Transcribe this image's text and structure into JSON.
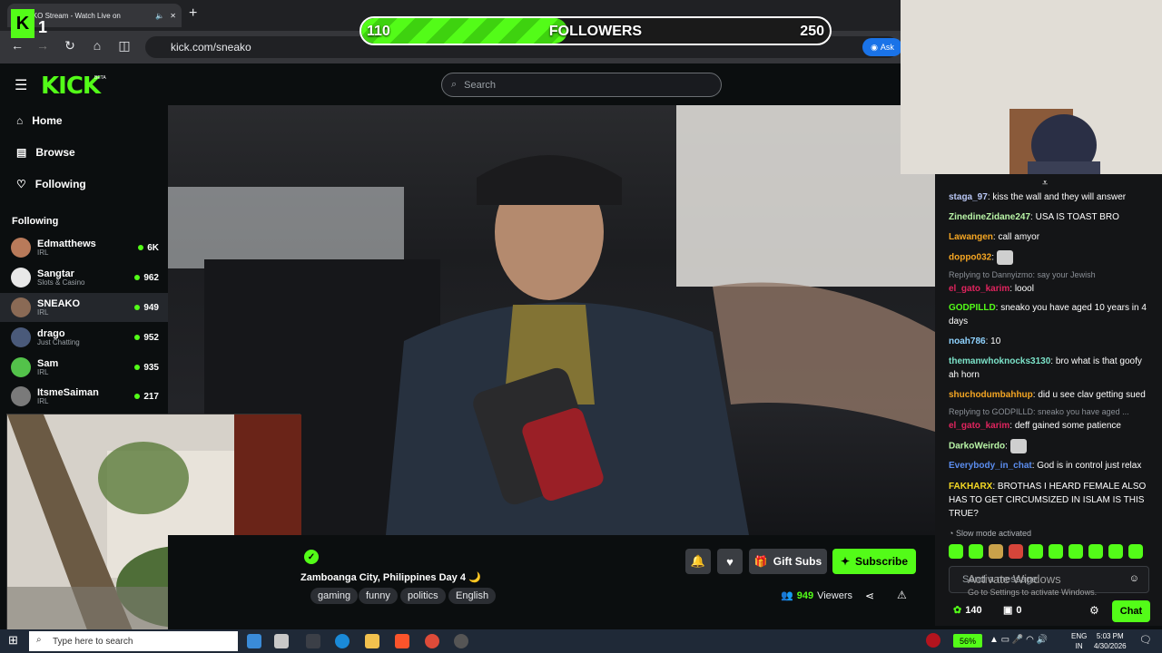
{
  "browser": {
    "tab_title": "SNEAKO Stream - Watch Live on",
    "new_tab": "+",
    "url": "kick.com/sneako",
    "ask_label": "Ask"
  },
  "overlay": {
    "logo_letter": "K",
    "logo_number": "1",
    "followers_current": "110",
    "followers_label": "FOLLOWERS",
    "followers_goal": "250",
    "followers_progress": 0.44
  },
  "kick": {
    "logo": "KICK",
    "beta": "BETA",
    "search_placeholder": "Search",
    "nav": [
      {
        "label": "Home",
        "icon": "home-icon"
      },
      {
        "label": "Browse",
        "icon": "browse-icon"
      },
      {
        "label": "Following",
        "icon": "heart-icon"
      }
    ],
    "following_header": "Following",
    "channels": [
      {
        "name": "Edmatthews",
        "category": "IRL",
        "viewers": "6K"
      },
      {
        "name": "Sangtar",
        "category": "Slots & Casino",
        "viewers": "962"
      },
      {
        "name": "SNEAKO",
        "category": "IRL",
        "viewers": "949"
      },
      {
        "name": "drago",
        "category": "Just Chatting",
        "viewers": "952"
      },
      {
        "name": "Sam",
        "category": "IRL",
        "viewers": "935"
      },
      {
        "name": "ItsmeSaiman",
        "category": "IRL",
        "viewers": "217"
      }
    ]
  },
  "stream": {
    "title": "Zamboanga City, Philippines Day 4 🌙",
    "tags": [
      "gaming",
      "funny",
      "politics",
      "English"
    ],
    "gift_label": "Gift Subs",
    "subscribe_label": "Subscribe",
    "viewer_count": "949",
    "viewers_label": "Viewers"
  },
  "chat": {
    "messages": [
      {
        "user": "staga_97",
        "color": "#b9c7f5",
        "text": "kiss the wall and they will answer"
      },
      {
        "user": "ZinedineZidane247",
        "color": "#b9f5a7",
        "text": "USA IS TOAST BRO"
      },
      {
        "user": "Lawangen",
        "color": "#f5a623",
        "text": "call amyor"
      },
      {
        "user": "doppo032",
        "color": "#f5a623",
        "text": ""
      },
      {
        "user": "el_gato_karim",
        "color": "#e0245e",
        "text": "loool",
        "reply": "Replying to Dannyizmo: say your Jewish"
      },
      {
        "user": "GODPILLD",
        "color": "#53fc18",
        "text": "sneako you have aged 10 years in 4 days"
      },
      {
        "user": "noah786",
        "color": "#8fd3ff",
        "text": "10"
      },
      {
        "user": "themanwhoknocks3130",
        "color": "#7ce3c9",
        "text": "bro what is that goofy ah horn"
      },
      {
        "user": "shuchodumbahhup",
        "color": "#f5a623",
        "text": "did u see clav getting sued"
      },
      {
        "user": "el_gato_karim",
        "color": "#e0245e",
        "text": "deff gained some patience",
        "reply": "Replying to GODPILLD: sneako you have aged ..."
      },
      {
        "user": "DarkoWeirdo",
        "color": "#b9f5a7",
        "text": ""
      },
      {
        "user": "Everybody_in_chat",
        "color": "#5b8def",
        "text": "God is in control just relax"
      },
      {
        "user": "FAKHARX",
        "color": "#f5d823",
        "text": "BROTHAS I HEARD FEMALE ALSO HAS TO GET CIRCUMSIZED IN ISLAM IS THIS TRUE?"
      }
    ],
    "slow_mode": "Slow mode activated",
    "input_placeholder": "Send a message",
    "win_activate": "Activate Windows",
    "win_activate_sub": "Go to Settings to activate Windows.",
    "kicks_count": "140",
    "second_count": "0",
    "chat_button": "Chat"
  },
  "taskbar": {
    "search_placeholder": "Type here to search",
    "battery": "56%",
    "lang_top": "ENG",
    "lang_bottom": "IN",
    "time": "5:03 PM",
    "date": "4/30/2026"
  }
}
